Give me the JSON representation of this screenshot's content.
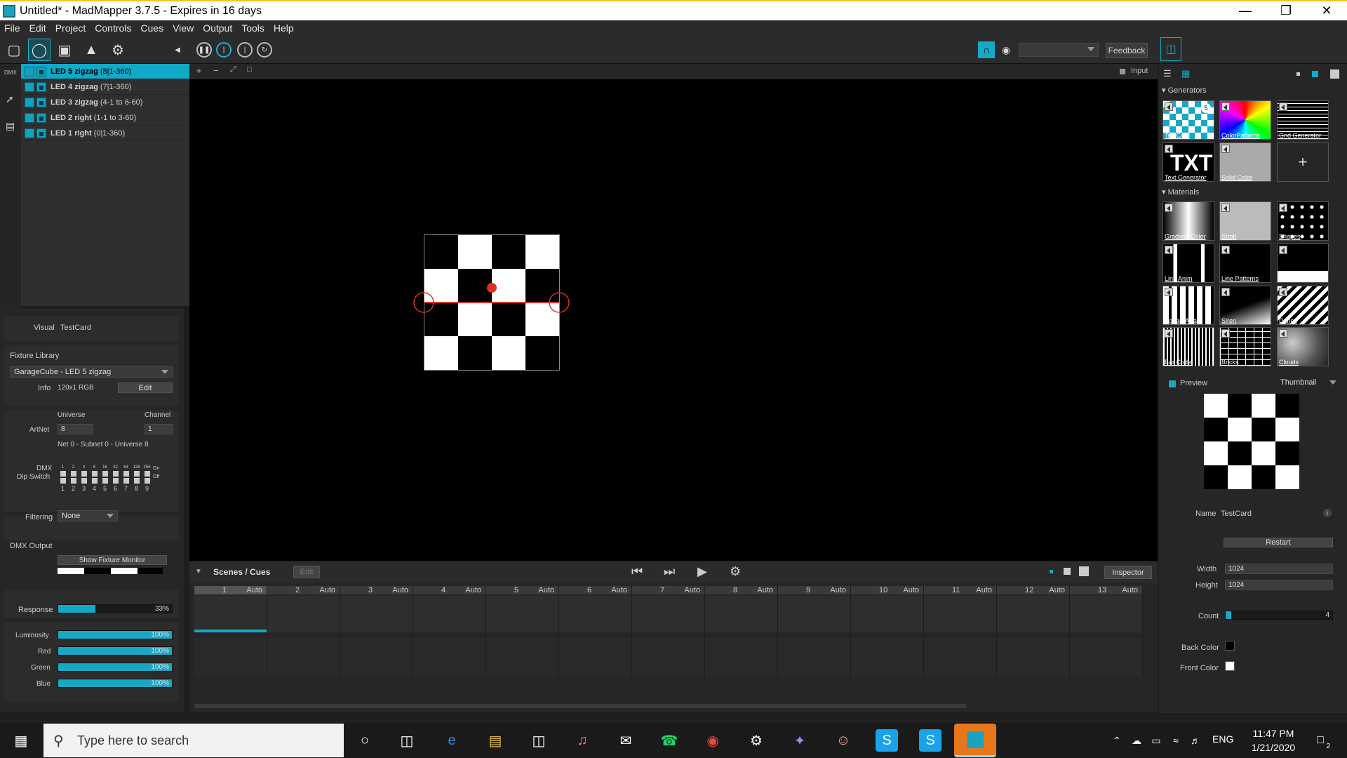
{
  "window": {
    "title": "Untitled* - MadMapper 3.7.5 - Expires in 16 days"
  },
  "menu": [
    "File",
    "Edit",
    "Project",
    "Controls",
    "Cues",
    "View",
    "Output",
    "Tools",
    "Help"
  ],
  "toolbar": {
    "feedback_label": "Feedback",
    "input_label": "Input"
  },
  "leftstrip": {
    "dmx_label": "DMX"
  },
  "fixtures": [
    {
      "name": "LED 5 zigzag",
      "detail": "(8|1-360)",
      "selected": true
    },
    {
      "name": "LED 4 zigzag",
      "detail": "(7|1-360)",
      "selected": false
    },
    {
      "name": "LED 3 zigzag",
      "detail": "(4-1 to 6-60)",
      "selected": false
    },
    {
      "name": "LED 2 right",
      "detail": "(1-1 to 3-60)",
      "selected": false
    },
    {
      "name": "LED 1 right",
      "detail": "(0|1-360)",
      "selected": false
    }
  ],
  "inspector": {
    "visual_label": "Visual",
    "visual_value": "TestCard",
    "fixture_library_label": "Fixture Library",
    "fixture_library_value": "GarageCube - LED 5 zigzag",
    "info_label": "Info",
    "info_value": "120x1 RGB",
    "edit_label": "Edit",
    "universe_label": "Universe",
    "channel_label": "Channel",
    "artnet_label": "ArtNet",
    "universe_value": "8",
    "channel_value": "1",
    "net_info": "Net 0 - Subnet 0 - Universe 8",
    "dmx_label": "DMX",
    "dip_label": "Dip Switch",
    "dip_on": "On",
    "dip_off": "Off",
    "dip_top": [
      "1",
      "2",
      "4",
      "8",
      "16",
      "32",
      "64",
      "128",
      "256"
    ],
    "dip_numbers": [
      "1",
      "2",
      "3",
      "4",
      "5",
      "6",
      "7",
      "8",
      "9"
    ],
    "filtering_label": "Filtering",
    "filtering_value": "None",
    "dmx_output_label": "DMX Output",
    "fixture_monitor_label": "Show Fixture Monitor",
    "response_label": "Response",
    "response_value": "33%",
    "response_level": 0.33,
    "luminosity_label": "Luminosity",
    "luminosity_value": "100%",
    "red_label": "Red",
    "red_value": "100%",
    "green_label": "Green",
    "green_value": "100%",
    "blue_label": "Blue",
    "blue_value": "100%"
  },
  "scenes": {
    "title": "Scenes / Cues",
    "edit_label": "Edit",
    "inspector_label": "Inspector",
    "cues": [
      {
        "num": "1",
        "mode": "Auto"
      },
      {
        "num": "2",
        "mode": "Auto"
      },
      {
        "num": "3",
        "mode": "Auto"
      },
      {
        "num": "4",
        "mode": "Auto"
      },
      {
        "num": "5",
        "mode": "Auto"
      },
      {
        "num": "6",
        "mode": "Auto"
      },
      {
        "num": "7",
        "mode": "Auto"
      },
      {
        "num": "8",
        "mode": "Auto"
      },
      {
        "num": "9",
        "mode": "Auto"
      },
      {
        "num": "10",
        "mode": "Auto"
      },
      {
        "num": "11",
        "mode": "Auto"
      },
      {
        "num": "12",
        "mode": "Auto"
      },
      {
        "num": "13",
        "mode": "Auto"
      }
    ]
  },
  "right": {
    "generators_label": "Generators",
    "generators": [
      "TestCard",
      "ColorPatterns",
      "Grid Generator",
      "Text Generator",
      "Solid Color"
    ],
    "testcard_badge": "5",
    "txt_glyph": "TXT",
    "materials_label": "Materials",
    "materials": [
      "Gradient Color",
      "Strob",
      "Shapes",
      "Line Anim",
      "Line Patterns",
      "LineRepeat",
      "SquareArray",
      "Siren",
      "Dunes",
      "Bar Code",
      "Bricks",
      "Clouds"
    ],
    "preview_label": "Preview",
    "preview_mode": "Thumbnail",
    "name_label": "Name",
    "name_value": "TestCard",
    "restart_label": "Restart",
    "width_label": "Width",
    "width_value": "1024",
    "height_label": "Height",
    "height_value": "1024",
    "count_label": "Count",
    "count_value": "4",
    "back_color_label": "Back Color",
    "front_color_label": "Front Color"
  },
  "taskbar": {
    "search_placeholder": "Type here to search",
    "lang": "ENG",
    "time": "11:47 PM",
    "date": "1/21/2020",
    "notif_count": "2"
  },
  "colors": {
    "accent": "#16a9c6",
    "background": "#1e1e1e"
  }
}
